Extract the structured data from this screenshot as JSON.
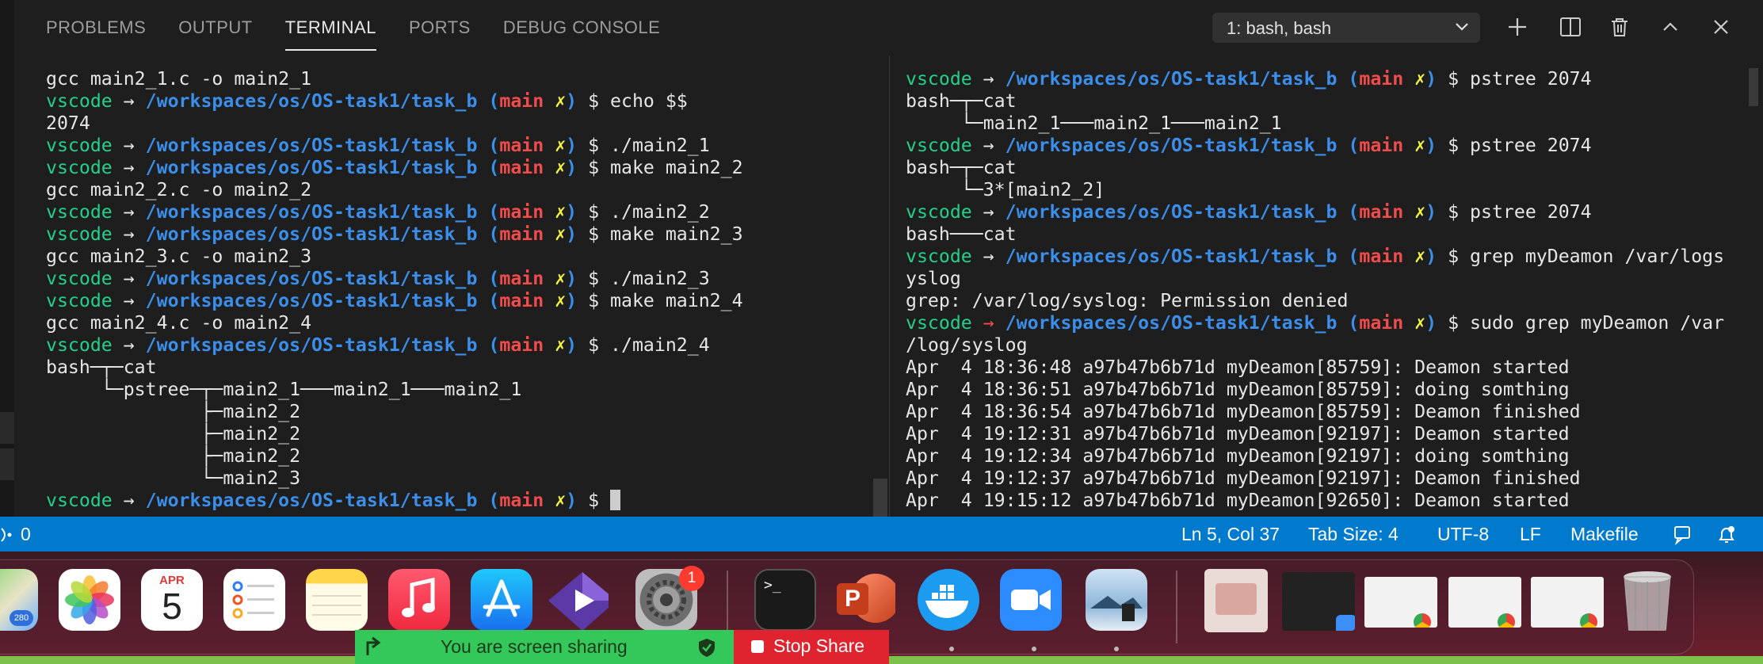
{
  "panel": {
    "tabs": [
      "PROBLEMS",
      "OUTPUT",
      "TERMINAL",
      "PORTS",
      "DEBUG CONSOLE"
    ],
    "active_tab": "TERMINAL",
    "terminal_select": "1: bash, bash",
    "actions": [
      "plus-icon",
      "split-icon",
      "trash-icon",
      "chevron-up-icon",
      "close-icon"
    ]
  },
  "prompt": {
    "user": "vscode",
    "arrow": "→",
    "path": "/workspaces/os/OS-task1/task_b",
    "branch": "main",
    "dirty": "✗",
    "dollar": "$"
  },
  "terminal_left": {
    "lines": [
      {
        "type": "out",
        "text": "gcc main2_1.c -o main2_1"
      },
      {
        "type": "prompt",
        "cmd": "echo $$"
      },
      {
        "type": "out",
        "text": "2074"
      },
      {
        "type": "prompt",
        "cmd": "./main2_1"
      },
      {
        "type": "prompt",
        "cmd": "make main2_2"
      },
      {
        "type": "out",
        "text": "gcc main2_2.c -o main2_2"
      },
      {
        "type": "prompt",
        "cmd": "./main2_2"
      },
      {
        "type": "prompt",
        "cmd": "make main2_3"
      },
      {
        "type": "out",
        "text": "gcc main2_3.c -o main2_3"
      },
      {
        "type": "prompt",
        "cmd": "./main2_3"
      },
      {
        "type": "prompt",
        "cmd": "make main2_4"
      },
      {
        "type": "out",
        "text": "gcc main2_4.c -o main2_4"
      },
      {
        "type": "prompt",
        "cmd": "./main2_4"
      },
      {
        "type": "out",
        "text": "bash─┬─cat"
      },
      {
        "type": "out",
        "text": "     └─pstree─┬─main2_1───main2_1───main2_1"
      },
      {
        "type": "out",
        "text": "              ├─main2_2"
      },
      {
        "type": "out",
        "text": "              ├─main2_2"
      },
      {
        "type": "out",
        "text": "              ├─main2_2"
      },
      {
        "type": "out",
        "text": "              └─main2_3"
      },
      {
        "type": "prompt",
        "cmd": "",
        "cursor": true
      }
    ]
  },
  "terminal_right": {
    "lines": [
      {
        "type": "prompt",
        "cmd": "pstree 2074"
      },
      {
        "type": "out",
        "text": "bash─┬─cat"
      },
      {
        "type": "out",
        "text": "     └─main2_1───main2_1───main2_1"
      },
      {
        "type": "prompt",
        "cmd": "pstree 2074"
      },
      {
        "type": "out",
        "text": "bash─┬─cat"
      },
      {
        "type": "out",
        "text": "     └─3*[main2_2]"
      },
      {
        "type": "prompt",
        "cmd": "pstree 2074"
      },
      {
        "type": "out",
        "text": "bash───cat"
      },
      {
        "type": "prompt",
        "cmd": "grep myDeamon /var/logs"
      },
      {
        "type": "out",
        "text": "yslog"
      },
      {
        "type": "out",
        "text": "grep: /var/log/syslog: Permission denied"
      },
      {
        "type": "prompt",
        "cmd": "sudo grep myDeamon /var",
        "arrow_red": true
      },
      {
        "type": "out",
        "text": "/log/syslog"
      },
      {
        "type": "out",
        "text": "Apr  4 18:36:48 a97b47b6b71d myDeamon[85759]: Deamon started"
      },
      {
        "type": "out",
        "text": "Apr  4 18:36:51 a97b47b6b71d myDeamon[85759]: doing somthing"
      },
      {
        "type": "out",
        "text": "Apr  4 18:36:54 a97b47b6b71d myDeamon[85759]: Deamon finished"
      },
      {
        "type": "out",
        "text": "Apr  4 19:12:31 a97b47b6b71d myDeamon[92197]: Deamon started"
      },
      {
        "type": "out",
        "text": "Apr  4 19:12:34 a97b47b6b71d myDeamon[92197]: doing somthing"
      },
      {
        "type": "out",
        "text": "Apr  4 19:12:37 a97b47b6b71d myDeamon[92197]: Deamon finished"
      },
      {
        "type": "out",
        "text": "Apr  4 19:15:12 a97b47b6b71d myDeamon[92650]: Deamon started"
      }
    ]
  },
  "statusbar": {
    "ports_count": "0",
    "cursor_pos": "Ln 5, Col 37",
    "tab_size": "Tab Size: 4",
    "encoding": "UTF-8",
    "eol": "LF",
    "language": "Makefile"
  },
  "dock": {
    "calendar_month": "APR",
    "calendar_day": "5",
    "settings_badge": "1",
    "maps_badge": "280",
    "terminal_glyph": ">_",
    "powerpoint_letter": "P"
  },
  "screen_share": {
    "message": "You are screen sharing",
    "stop_label": "Stop Share"
  },
  "colors": {
    "prompt_user": "#23d18b",
    "prompt_path": "#3b8eea",
    "prompt_branch": "#f14c4c",
    "prompt_dirty": "#f5f543",
    "statusbar": "#007acc"
  }
}
